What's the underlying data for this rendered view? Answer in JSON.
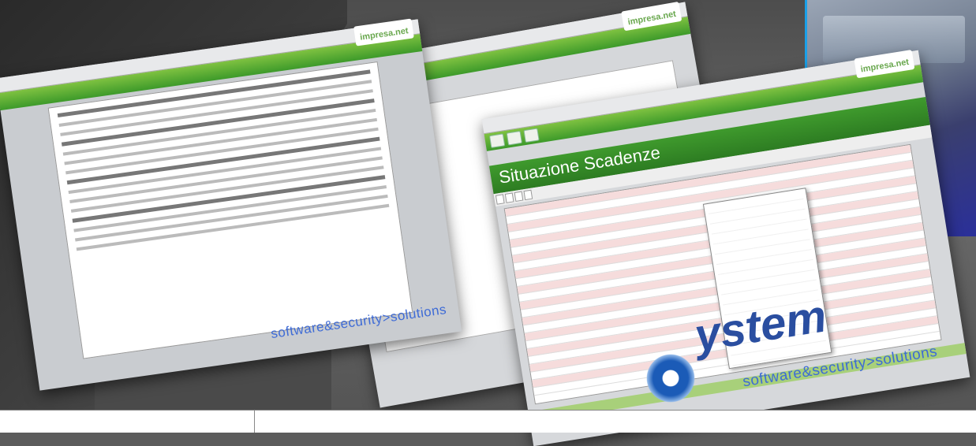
{
  "brand": {
    "logo_text": "impresa",
    "logo_suffix": ".net",
    "tagline": "software&security>solutions",
    "company_partial": "ystem"
  },
  "window_right": {
    "title": "Situazione Scadenze"
  },
  "colors": {
    "green": "#3d9a2a",
    "blue_text": "#3e6bd6",
    "accent_blue": "#1aa0e8"
  }
}
